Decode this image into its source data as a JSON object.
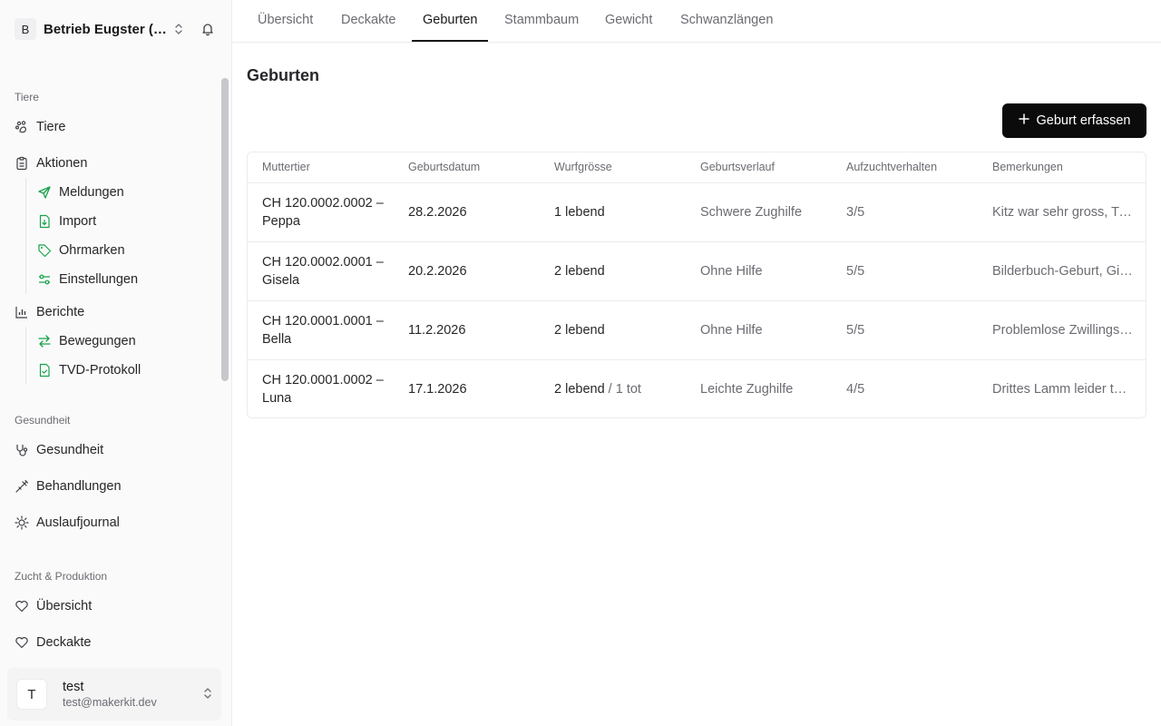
{
  "org": {
    "initial": "B",
    "name": "Betrieb Eugster (Hauptbetrieb)"
  },
  "sidebar": {
    "groups": [
      {
        "label": "Tiere"
      },
      {
        "label": "Gesundheit"
      },
      {
        "label": "Zucht & Produktion"
      }
    ],
    "items": {
      "tiere": "Tiere",
      "aktionen": "Aktionen",
      "meldungen": "Meldungen",
      "import": "Import",
      "ohrmarken": "Ohrmarken",
      "einstellungen": "Einstellungen",
      "berichte": "Berichte",
      "bewegungen": "Bewegungen",
      "tvd": "TVD-Protokoll",
      "gesundheit": "Gesundheit",
      "behandlungen": "Behandlungen",
      "auslauf": "Auslaufjournal",
      "uebersicht": "Übersicht",
      "deckakte": "Deckakte"
    }
  },
  "user": {
    "initial": "T",
    "name": "test",
    "email": "test@makerkit.dev"
  },
  "tabs": [
    "Übersicht",
    "Deckakte",
    "Geburten",
    "Stammbaum",
    "Gewicht",
    "Schwanzlängen"
  ],
  "page": {
    "title": "Geburten",
    "add_button": "Geburt erfassen"
  },
  "table": {
    "columns": [
      "Muttertier",
      "Geburtsdatum",
      "Wurfgrösse",
      "Geburtsverlauf",
      "Aufzuchtverhalten",
      "Bemerkungen"
    ],
    "rows": [
      {
        "mother_line1": "CH 120.0002.0002 –",
        "mother_line2": "Peppa",
        "date": "28.2.2026",
        "litter": "1 lebend",
        "litter_extra": "",
        "course": "Schwere Zughilfe",
        "rearing": "3/5",
        "notes": "Kitz war sehr gross, Tierarzt nicht nötig"
      },
      {
        "mother_line1": "CH 120.0002.0001 –",
        "mother_line2": "Gisela",
        "date": "20.2.2026",
        "litter": "2 lebend",
        "litter_extra": "",
        "course": "Ohne Hilfe",
        "rearing": "5/5",
        "notes": "Bilderbuch-Geburt, Gitzi trinken gut"
      },
      {
        "mother_line1": "CH 120.0001.0001 –",
        "mother_line2": "Bella",
        "date": "11.2.2026",
        "litter": "2 lebend",
        "litter_extra": "",
        "course": "Ohne Hilfe",
        "rearing": "5/5",
        "notes": "Problemlose Zwillingsgeburt"
      },
      {
        "mother_line1": "CH 120.0001.0002 –",
        "mother_line2": "Luna",
        "date": "17.1.2026",
        "litter": "2 lebend",
        "litter_extra": "/ 1 tot",
        "course": "Leichte Zughilfe",
        "rearing": "4/5",
        "notes": "Drittes Lamm leider tot geboren"
      }
    ]
  },
  "colors": {
    "accent": "#0b0b0c",
    "nav_icon_green": "#16a34a",
    "muted": "#6b6b72"
  }
}
